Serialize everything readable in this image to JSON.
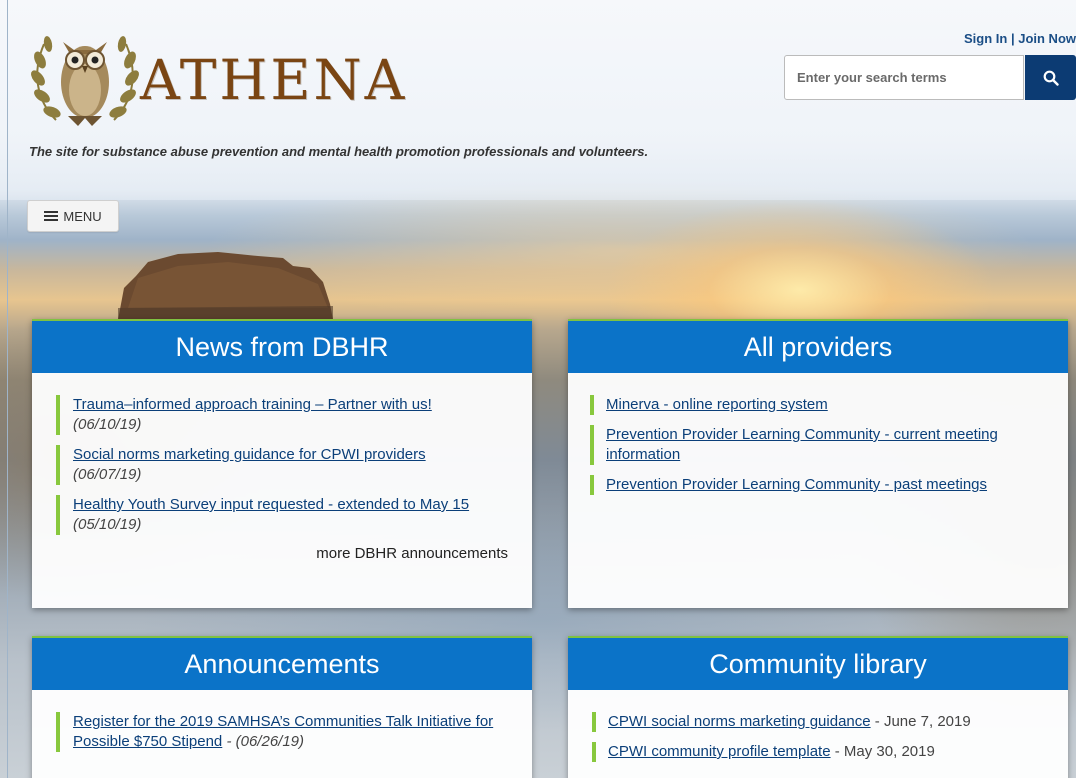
{
  "header": {
    "logo_text": "ATHENA",
    "tagline": "The site for substance abuse prevention and mental health promotion professionals and volunteers.",
    "sign_in_label": "Sign In",
    "separator": " | ",
    "join_label": "Join Now",
    "search": {
      "placeholder": "Enter your search terms",
      "value": ""
    },
    "search_icon": "search-icon",
    "menu_label": "MENU",
    "menu_icon": "hamburger-icon",
    "brand_color": "#7a4513",
    "accent_color": "#0b73c8"
  },
  "cards": {
    "news": {
      "title": "News from DBHR",
      "items": [
        {
          "link": "Trauma–informed approach training – Partner with us!",
          "date": "(06/10/19)"
        },
        {
          "link": "Social norms marketing guidance for CPWI providers",
          "date": "(06/07/19)"
        },
        {
          "link": "Healthy Youth Survey input requested - extended to May 15",
          "date": "(05/10/19)"
        }
      ],
      "more": "more DBHR announcements"
    },
    "providers": {
      "title": "All providers",
      "items": [
        {
          "link": "Minerva - online reporting system"
        },
        {
          "link": "Prevention Provider Learning Community - current meeting information"
        },
        {
          "link": "Prevention Provider Learning Community - past meetings"
        }
      ]
    },
    "announcements": {
      "title": "Announcements",
      "items": [
        {
          "link": "Register for the 2019 SAMHSA’s Communities Talk Initiative for Possible $750 Stipend",
          "date": "(06/26/19)"
        }
      ]
    },
    "library": {
      "title": "Community library",
      "items": [
        {
          "link": "CPWI social norms marketing guidance",
          "date": "June 7, 2019"
        },
        {
          "link": "CPWI community profile template",
          "date": "May 30, 2019"
        }
      ]
    }
  }
}
